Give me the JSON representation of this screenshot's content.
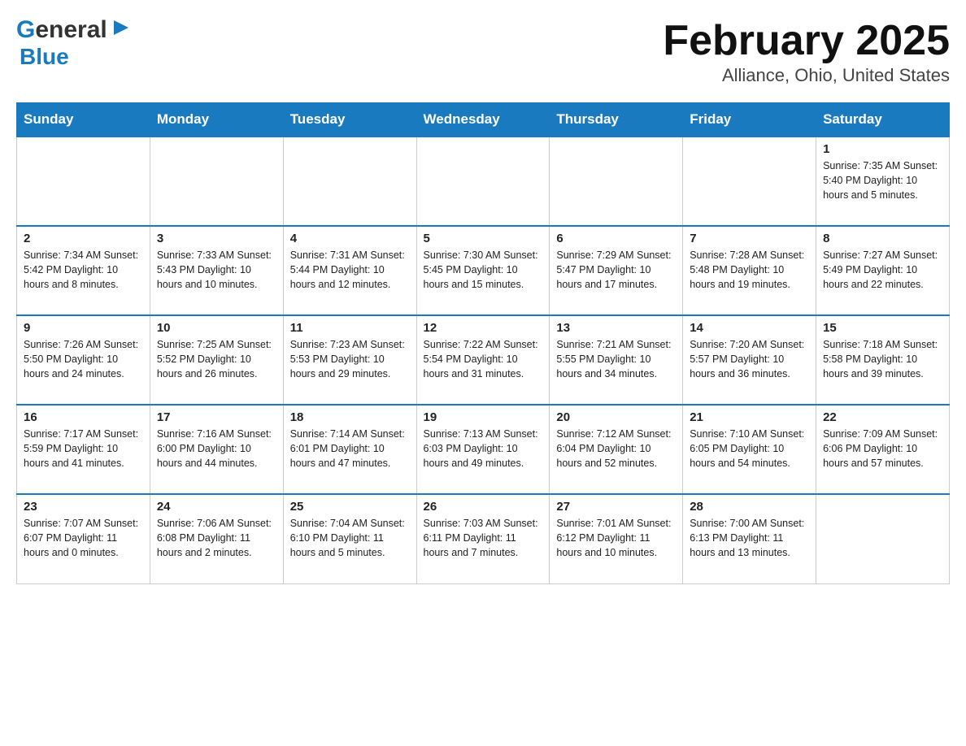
{
  "logo": {
    "general": "General",
    "blue": "Blue",
    "arrow_symbol": "▶"
  },
  "title": "February 2025",
  "subtitle": "Alliance, Ohio, United States",
  "days_of_week": [
    "Sunday",
    "Monday",
    "Tuesday",
    "Wednesday",
    "Thursday",
    "Friday",
    "Saturday"
  ],
  "weeks": [
    {
      "cells": [
        {
          "day": "",
          "info": ""
        },
        {
          "day": "",
          "info": ""
        },
        {
          "day": "",
          "info": ""
        },
        {
          "day": "",
          "info": ""
        },
        {
          "day": "",
          "info": ""
        },
        {
          "day": "",
          "info": ""
        },
        {
          "day": "1",
          "info": "Sunrise: 7:35 AM\nSunset: 5:40 PM\nDaylight: 10 hours and 5 minutes."
        }
      ]
    },
    {
      "cells": [
        {
          "day": "2",
          "info": "Sunrise: 7:34 AM\nSunset: 5:42 PM\nDaylight: 10 hours and 8 minutes."
        },
        {
          "day": "3",
          "info": "Sunrise: 7:33 AM\nSunset: 5:43 PM\nDaylight: 10 hours and 10 minutes."
        },
        {
          "day": "4",
          "info": "Sunrise: 7:31 AM\nSunset: 5:44 PM\nDaylight: 10 hours and 12 minutes."
        },
        {
          "day": "5",
          "info": "Sunrise: 7:30 AM\nSunset: 5:45 PM\nDaylight: 10 hours and 15 minutes."
        },
        {
          "day": "6",
          "info": "Sunrise: 7:29 AM\nSunset: 5:47 PM\nDaylight: 10 hours and 17 minutes."
        },
        {
          "day": "7",
          "info": "Sunrise: 7:28 AM\nSunset: 5:48 PM\nDaylight: 10 hours and 19 minutes."
        },
        {
          "day": "8",
          "info": "Sunrise: 7:27 AM\nSunset: 5:49 PM\nDaylight: 10 hours and 22 minutes."
        }
      ]
    },
    {
      "cells": [
        {
          "day": "9",
          "info": "Sunrise: 7:26 AM\nSunset: 5:50 PM\nDaylight: 10 hours and 24 minutes."
        },
        {
          "day": "10",
          "info": "Sunrise: 7:25 AM\nSunset: 5:52 PM\nDaylight: 10 hours and 26 minutes."
        },
        {
          "day": "11",
          "info": "Sunrise: 7:23 AM\nSunset: 5:53 PM\nDaylight: 10 hours and 29 minutes."
        },
        {
          "day": "12",
          "info": "Sunrise: 7:22 AM\nSunset: 5:54 PM\nDaylight: 10 hours and 31 minutes."
        },
        {
          "day": "13",
          "info": "Sunrise: 7:21 AM\nSunset: 5:55 PM\nDaylight: 10 hours and 34 minutes."
        },
        {
          "day": "14",
          "info": "Sunrise: 7:20 AM\nSunset: 5:57 PM\nDaylight: 10 hours and 36 minutes."
        },
        {
          "day": "15",
          "info": "Sunrise: 7:18 AM\nSunset: 5:58 PM\nDaylight: 10 hours and 39 minutes."
        }
      ]
    },
    {
      "cells": [
        {
          "day": "16",
          "info": "Sunrise: 7:17 AM\nSunset: 5:59 PM\nDaylight: 10 hours and 41 minutes."
        },
        {
          "day": "17",
          "info": "Sunrise: 7:16 AM\nSunset: 6:00 PM\nDaylight: 10 hours and 44 minutes."
        },
        {
          "day": "18",
          "info": "Sunrise: 7:14 AM\nSunset: 6:01 PM\nDaylight: 10 hours and 47 minutes."
        },
        {
          "day": "19",
          "info": "Sunrise: 7:13 AM\nSunset: 6:03 PM\nDaylight: 10 hours and 49 minutes."
        },
        {
          "day": "20",
          "info": "Sunrise: 7:12 AM\nSunset: 6:04 PM\nDaylight: 10 hours and 52 minutes."
        },
        {
          "day": "21",
          "info": "Sunrise: 7:10 AM\nSunset: 6:05 PM\nDaylight: 10 hours and 54 minutes."
        },
        {
          "day": "22",
          "info": "Sunrise: 7:09 AM\nSunset: 6:06 PM\nDaylight: 10 hours and 57 minutes."
        }
      ]
    },
    {
      "cells": [
        {
          "day": "23",
          "info": "Sunrise: 7:07 AM\nSunset: 6:07 PM\nDaylight: 11 hours and 0 minutes."
        },
        {
          "day": "24",
          "info": "Sunrise: 7:06 AM\nSunset: 6:08 PM\nDaylight: 11 hours and 2 minutes."
        },
        {
          "day": "25",
          "info": "Sunrise: 7:04 AM\nSunset: 6:10 PM\nDaylight: 11 hours and 5 minutes."
        },
        {
          "day": "26",
          "info": "Sunrise: 7:03 AM\nSunset: 6:11 PM\nDaylight: 11 hours and 7 minutes."
        },
        {
          "day": "27",
          "info": "Sunrise: 7:01 AM\nSunset: 6:12 PM\nDaylight: 11 hours and 10 minutes."
        },
        {
          "day": "28",
          "info": "Sunrise: 7:00 AM\nSunset: 6:13 PM\nDaylight: 11 hours and 13 minutes."
        },
        {
          "day": "",
          "info": ""
        }
      ]
    }
  ]
}
